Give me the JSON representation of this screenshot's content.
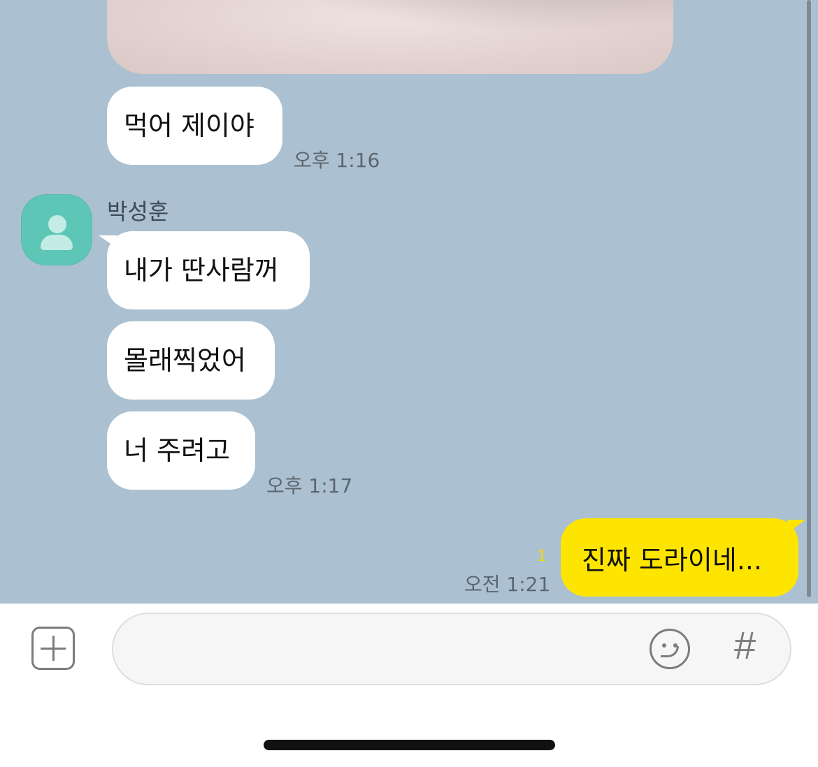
{
  "messages": [
    {
      "text": "먹어 제이야",
      "time": "오후 1:16"
    },
    {
      "sender": "박성훈",
      "text": "내가 딴사람꺼"
    },
    {
      "text": "몰래찍었어"
    },
    {
      "text": "너 주려고",
      "time": "오후 1:17"
    }
  ],
  "my_message": {
    "text": "진짜 도라이네...",
    "unread": "1",
    "time": "오전 1:21"
  },
  "input": {
    "placeholder": "",
    "hash_label": "#"
  },
  "colors": {
    "chat_bg": "#abc1d1",
    "my_bubble": "#fee500",
    "avatar": "#5ec6b6"
  },
  "icons": [
    "plus-icon",
    "emoji-icon",
    "hash-icon",
    "profile-icon"
  ]
}
